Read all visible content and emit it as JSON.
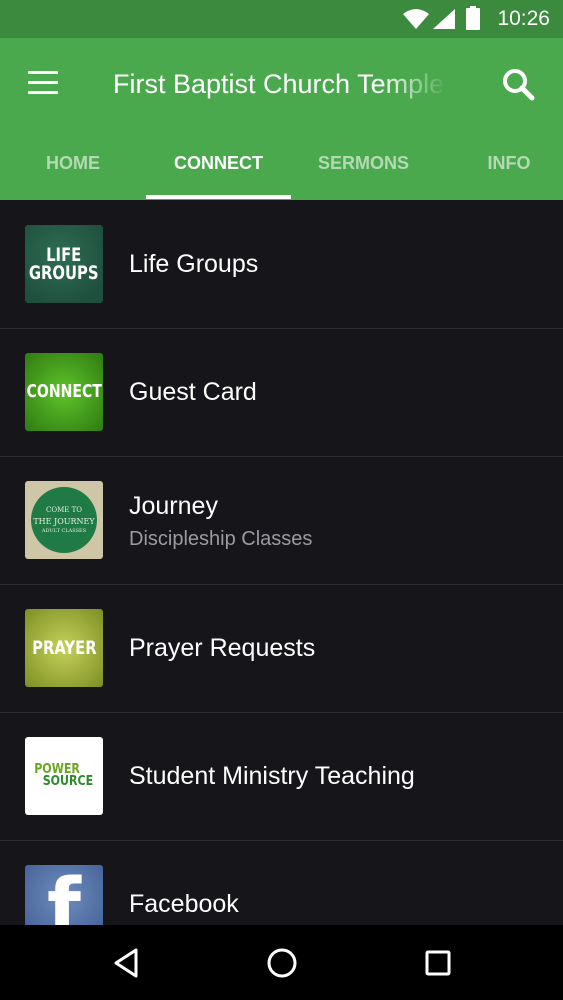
{
  "status_bar": {
    "time": "10:26"
  },
  "app_bar": {
    "title": "First Baptist Church Temple"
  },
  "tabs": [
    {
      "label": "HOME"
    },
    {
      "label": "CONNECT",
      "active": true
    },
    {
      "label": "SERMONS"
    },
    {
      "label": "INFO"
    }
  ],
  "list": [
    {
      "label": "Life Groups",
      "thumb_text": [
        "LIFE",
        "GROUPS"
      ]
    },
    {
      "label": "Guest Card",
      "thumb_text": "CONNECT"
    },
    {
      "label": "Journey",
      "sublabel": "Discipleship Classes",
      "thumb_text": [
        "COME TO",
        "THE JOURNEY",
        "ADULT CLASSES"
      ]
    },
    {
      "label": "Prayer Requests",
      "thumb_text": "PRAYER"
    },
    {
      "label": "Student Ministry Teaching",
      "thumb_text": [
        "POWER",
        "SOURCE"
      ]
    },
    {
      "label": "Facebook",
      "thumb_text": "f"
    }
  ],
  "colors": {
    "primary": "#4aa84d",
    "status_bar": "#3b8a3e",
    "background": "#16161a"
  }
}
